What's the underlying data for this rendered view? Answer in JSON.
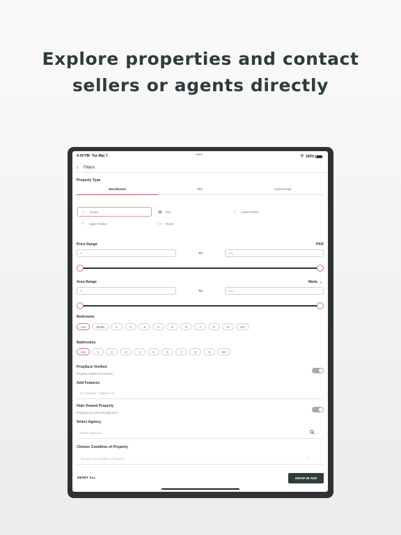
{
  "headline": {
    "line1": "Explore properties and contact",
    "line2": "sellers or agents directly"
  },
  "status_bar": {
    "time": "4:43 PM",
    "date": "Tue Mar 7",
    "dots": "•••",
    "wifi_icon": "wifi-icon",
    "battery": "100%"
  },
  "nav": {
    "back_icon": "‹",
    "title": "Filters"
  },
  "property_type": {
    "label": "Property Type",
    "tabs": [
      "Residential",
      "Plot",
      "Commercial"
    ],
    "active_tab": 0,
    "options": [
      {
        "label": "House",
        "icon": "⌂",
        "selected": true
      },
      {
        "label": "Flat",
        "icon": "▦",
        "selected": false
      },
      {
        "label": "Lower Portion",
        "icon": "⌂",
        "selected": false
      },
      {
        "label": "Upper Portion",
        "icon": "⌂",
        "selected": false
      },
      {
        "label": "Room",
        "icon": "▭",
        "selected": false
      }
    ]
  },
  "price_range": {
    "label": "Price Range",
    "unit": "PKR",
    "min_value": "0",
    "to_label": "TO",
    "max_placeholder": "Any"
  },
  "area_range": {
    "label": "Area Range",
    "unit": "Marla",
    "min_value": "0",
    "to_label": "TO",
    "max_placeholder": "Any"
  },
  "bedrooms": {
    "label": "Bedrooms",
    "options": [
      "Any",
      "Studio",
      "1",
      "2",
      "3",
      "4",
      "5",
      "6",
      "7",
      "8",
      "9",
      "10+"
    ],
    "selected": 0
  },
  "bathrooms": {
    "label": "Bathrooms",
    "options": [
      "Any",
      "1",
      "2",
      "3",
      "4",
      "5",
      "6",
      "7",
      "8",
      "9",
      "10+"
    ],
    "selected": 0
  },
  "verified": {
    "label": "PropSure Verified",
    "sub": "Property Verified by Graana",
    "enabled": false
  },
  "features": {
    "label": "Add Features",
    "placeholder": "Try \"Balcony\", \"Gallery\" etc."
  },
  "hide_viewed": {
    "label": "Hide Viewed Property",
    "sub": "Property you have already seen",
    "enabled": false
  },
  "agency": {
    "label": "Select Agency",
    "placeholder": "Search Agencies"
  },
  "condition": {
    "label": "Choose Condition of Property",
    "placeholder": "Choose your condition of property"
  },
  "footer": {
    "reset_label": "RESET ALL",
    "show_label": "SHOW 90 ADS"
  },
  "colors": {
    "accent": "#d36b70",
    "dark": "#2f3b3d",
    "bezel": "#2f3134"
  }
}
